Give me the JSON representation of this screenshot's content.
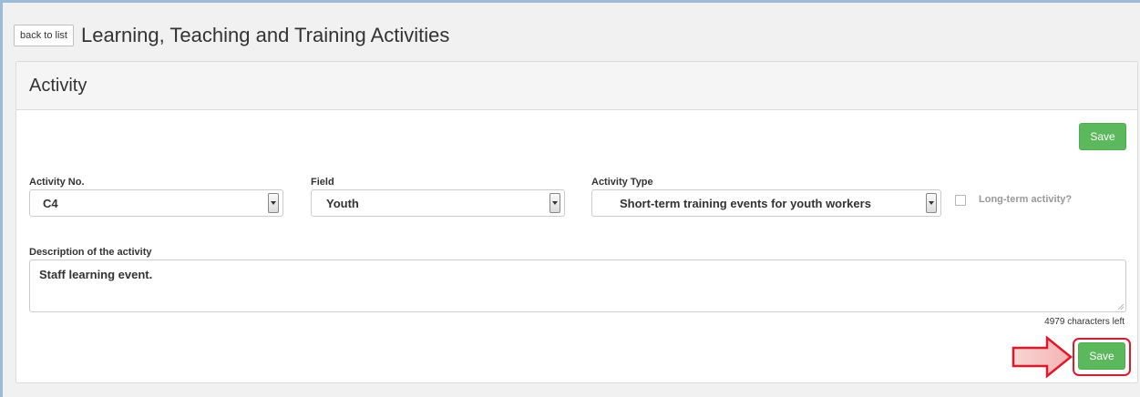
{
  "header": {
    "back_label": "back to list",
    "title": "Learning, Teaching and Training Activities"
  },
  "panel": {
    "title": "Activity",
    "save_label": "Save"
  },
  "form": {
    "activity_no": {
      "label": "Activity No.",
      "value": "C4"
    },
    "field": {
      "label": "Field",
      "value": "Youth"
    },
    "activity_type": {
      "label": "Activity Type",
      "value": "Short-term training events for youth workers"
    },
    "long_term": {
      "label": "Long-term activity?",
      "checked": false
    },
    "description": {
      "label": "Description of the activity",
      "value": "Staff learning event.",
      "chars_left": "4979 characters left"
    }
  },
  "colors": {
    "save_green": "#5cb85c",
    "highlight_red": "#e0182a",
    "window_border": "#9dbbd6"
  }
}
